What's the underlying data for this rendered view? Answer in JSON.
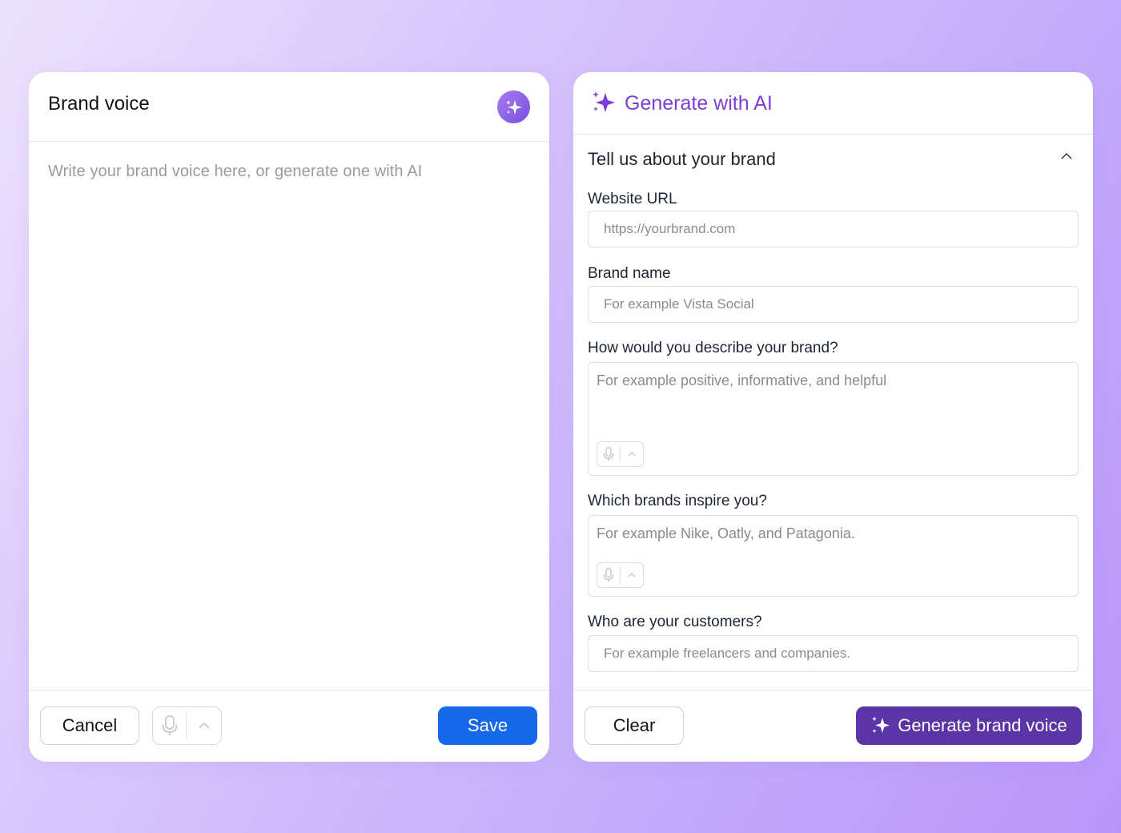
{
  "brand_voice": {
    "title": "Brand voice",
    "ai_button_icon": "sparkle-icon",
    "editor_placeholder": "Write your brand voice here, or generate one with AI",
    "footer": {
      "cancel_label": "Cancel",
      "save_label": "Save",
      "mic_icon": "microphone-icon",
      "expand_icon": "chevron-up-icon"
    }
  },
  "generate": {
    "title": "Generate with AI",
    "title_icon": "sparkle-icon",
    "section_title": "Tell us about your brand",
    "fields": {
      "website_url": {
        "label": "Website URL",
        "placeholder": "https://yourbrand.com"
      },
      "brand_name": {
        "label": "Brand name",
        "placeholder": "For example Vista Social"
      },
      "describe": {
        "label": "How would you describe your brand?",
        "placeholder": "For example positive, informative, and helpful"
      },
      "inspire": {
        "label": "Which brands inspire you?",
        "placeholder": "For example Nike, Oatly, and Patagonia."
      },
      "customers": {
        "label": "Who are your customers?",
        "placeholder": "For example freelancers and companies."
      }
    },
    "footer": {
      "clear_label": "Clear",
      "generate_label": "Generate brand voice"
    }
  },
  "colors": {
    "save_button": "#1469e8",
    "generate_button": "#5b34a6",
    "accent_purple": "#7a3fd6"
  }
}
